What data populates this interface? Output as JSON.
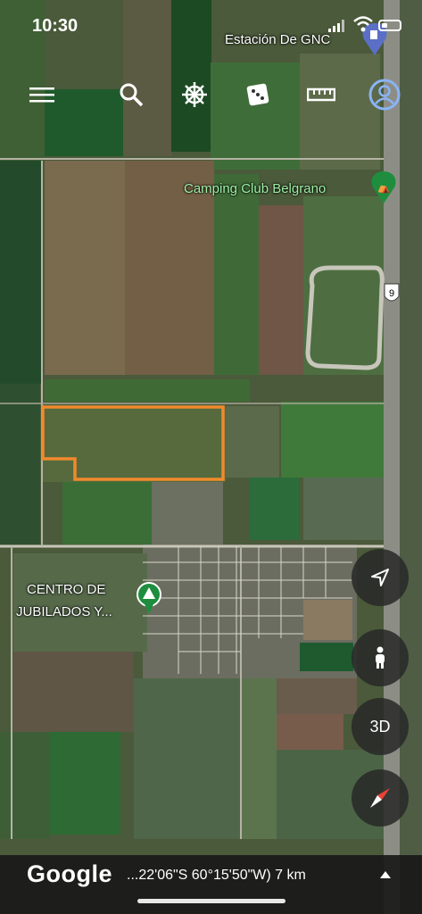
{
  "status_bar": {
    "time": "10:30"
  },
  "toolbar": {
    "icons": [
      "menu-icon",
      "search-icon",
      "ship-wheel-icon",
      "dice-icon",
      "ruler-icon",
      "account-icon"
    ]
  },
  "map": {
    "places": {
      "gas_station": "Estación De GNC",
      "camping": "Camping Club Belgrano",
      "route": "9",
      "centro_line1": "CENTRO DE",
      "centro_line2": "JUBILADOS Y..."
    },
    "highlight_color": "#f08a2c"
  },
  "controls": {
    "locate_icon": "navigation-arrow-icon",
    "pegman_icon": "person-icon",
    "view_3d": "3D",
    "compass_icon": "compass-icon"
  },
  "footer": {
    "logo": "Google",
    "coordinates": "...22'06\"S 60°15'50\"W) 7 km"
  }
}
